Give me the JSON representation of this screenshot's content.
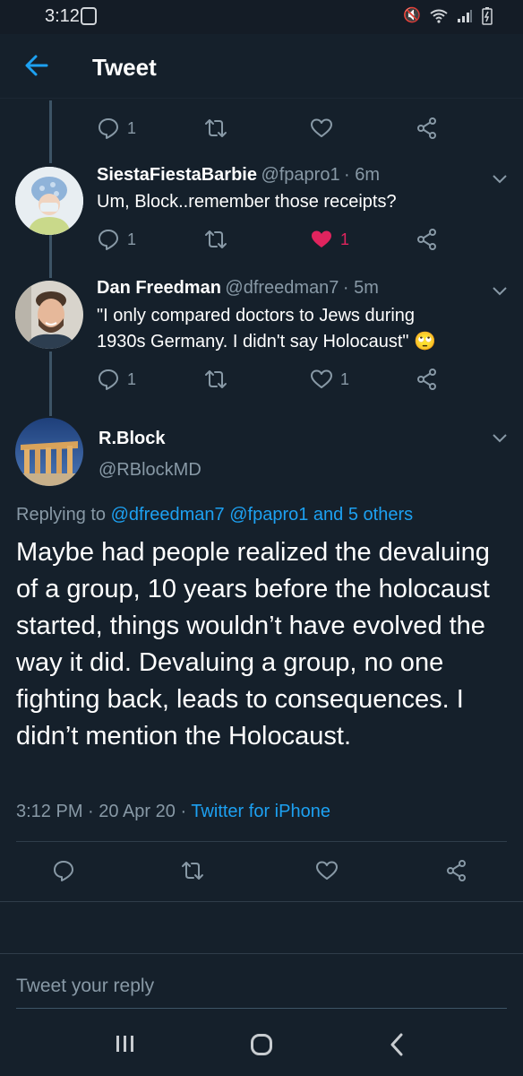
{
  "status_bar": {
    "time": "3:12"
  },
  "app_bar": {
    "title": "Tweet"
  },
  "prev_tweet_actions": {
    "reply_count": "1",
    "retweet_count": "",
    "like_count": ""
  },
  "tweets": [
    {
      "name": "SiestaFiestaBarbie",
      "handle": "@fpapro1",
      "time": "· 6m",
      "text": "Um, Block..remember those receipts?",
      "reply_count": "1",
      "like_count": "1",
      "liked": true
    },
    {
      "name": "Dan Freedman",
      "handle": "@dfreedman7",
      "time": "· 5m",
      "text_line1": "\"I only compared doctors to Jews during",
      "text_line2": "1930s Germany. I didn't say Holocaust\"",
      "emoji": "🙄",
      "reply_count": "1",
      "like_count": "1",
      "liked": false
    }
  ],
  "main_tweet": {
    "name": "R.Block",
    "handle": "@RBlockMD",
    "replying_prefix": "Replying to",
    "replying_to": "@dfreedman7 @fpapro1 and 5 others",
    "text": "Maybe had people realized the devaluing of a group, 10 years before the holocaust started, things wouldn’t have evolved the way it did. Devaluing a group, no one fighting back, leads to consequences. I didn’t mention the Holocaust.",
    "timestamp": "3:12 PM · 20 Apr 20 ·",
    "source": "Twitter for iPhone"
  },
  "reply_bar": {
    "placeholder": "Tweet your reply"
  },
  "colors": {
    "background": "#15202b",
    "accent": "#1da1f2",
    "muted": "#8899a6",
    "like": "#e0245e"
  }
}
